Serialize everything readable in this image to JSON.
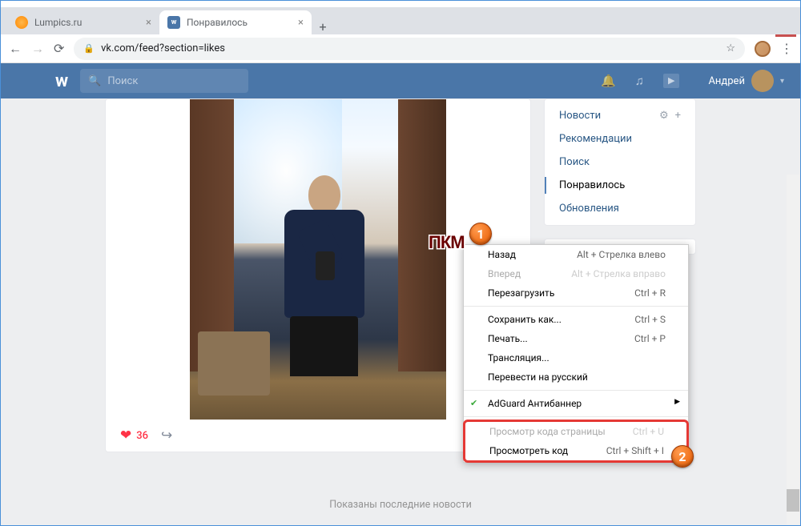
{
  "window": {
    "min": "—",
    "max": "☐",
    "close": "✕"
  },
  "tabs": [
    {
      "title": "Lumpics.ru"
    },
    {
      "title": "Понравилось",
      "favicon_text": "w"
    }
  ],
  "new_tab": "+",
  "nav": {
    "back": "←",
    "forward": "→",
    "reload": "⟳"
  },
  "address": {
    "lock": "🔒",
    "url": "vk.com/feed?section=likes",
    "star": "☆",
    "menu": "⋮"
  },
  "vk": {
    "logo": "w",
    "search_icon": "🔍",
    "search_placeholder": "Поиск",
    "icons": {
      "bell": "🔔",
      "music": "♫",
      "video": "▶"
    },
    "user_name": "Андрей",
    "chev": "▾"
  },
  "sidebar": {
    "items": [
      "Новости",
      "Рекомендации",
      "Поиск",
      "Понравилось",
      "Обновления"
    ],
    "filter": "⚙",
    "plus": "+"
  },
  "post": {
    "like_icon": "❤",
    "like_count": "36",
    "share_icon": "↪"
  },
  "footer": "Показаны последние новости",
  "ctx": {
    "items": [
      {
        "label": "Назад",
        "shortcut": "Alt + Стрелка влево"
      },
      {
        "label": "Вперед",
        "shortcut": "Alt + Стрелка вправо",
        "disabled": true
      },
      {
        "label": "Перезагрузить",
        "shortcut": "Ctrl + R"
      },
      {
        "label": "Сохранить как...",
        "shortcut": "Ctrl + S"
      },
      {
        "label": "Печать...",
        "shortcut": "Ctrl + P"
      },
      {
        "label": "Трансляция..."
      },
      {
        "label": "Перевести на русский"
      },
      {
        "label": "AdGuard Антибаннер",
        "check": "✔",
        "arrow": "▶"
      },
      {
        "label": "Просмотр кода страницы",
        "shortcut": "Ctrl + U",
        "disabled": true
      },
      {
        "label": "Просмотреть код",
        "shortcut": "Ctrl + Shift + I"
      }
    ]
  },
  "anno": {
    "pkm": "ПКМ",
    "b1": "1",
    "b2": "2"
  }
}
